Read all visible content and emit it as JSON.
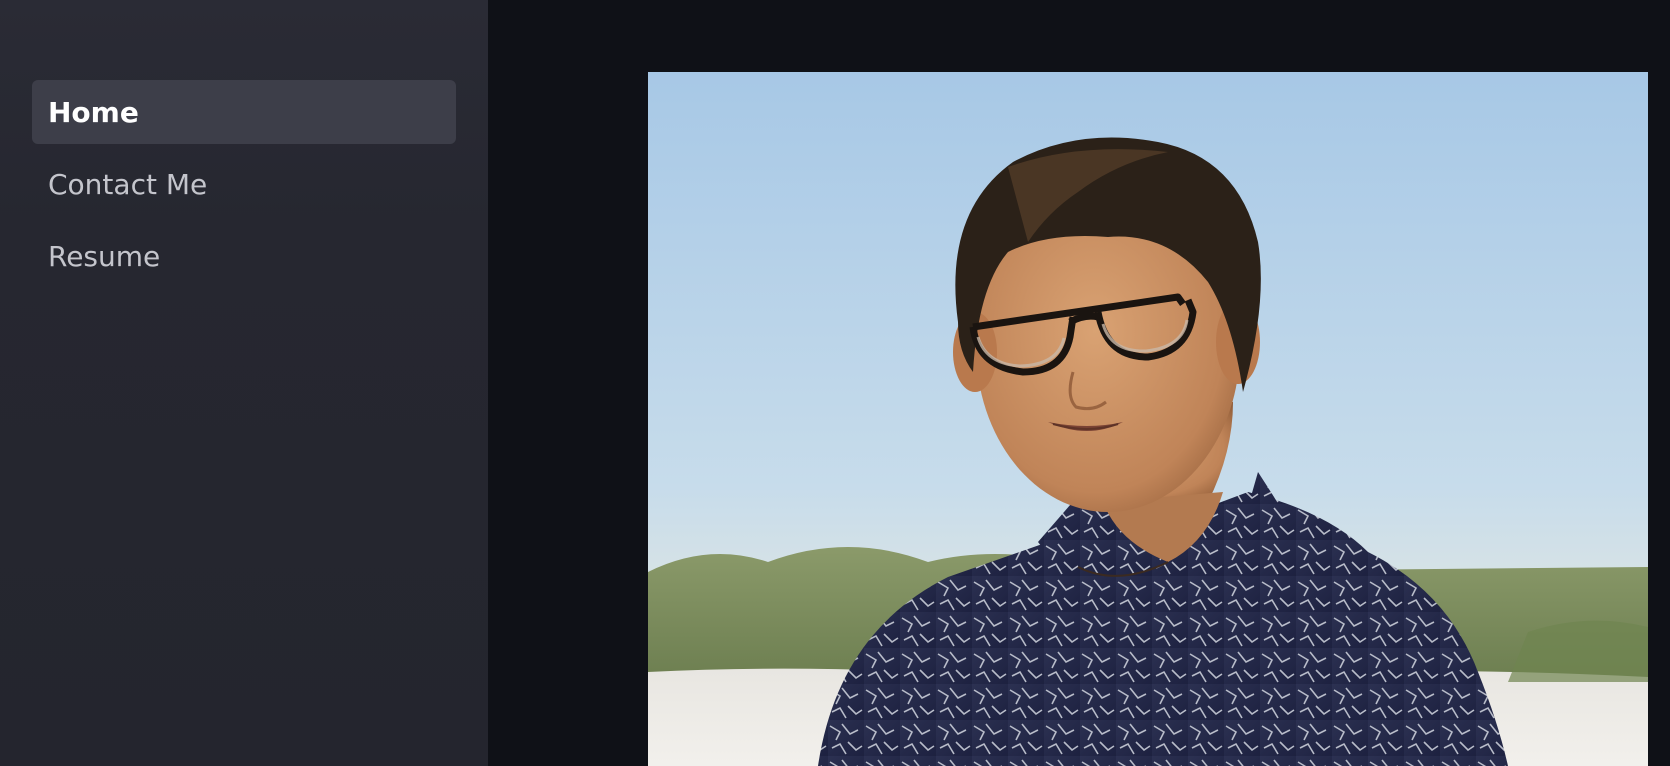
{
  "sidebar": {
    "items": [
      {
        "label": "Home",
        "active": true
      },
      {
        "label": "Contact Me",
        "active": false
      },
      {
        "label": "Resume",
        "active": false
      }
    ]
  },
  "main": {
    "image": {
      "alt": "",
      "icon": "portrait-photo"
    }
  },
  "colors": {
    "sidebar_bg": "#262730",
    "main_bg": "#0f1117",
    "active_item_bg": "#3d3e49",
    "active_text": "#ffffff",
    "inactive_text": "#c4c5cc"
  }
}
